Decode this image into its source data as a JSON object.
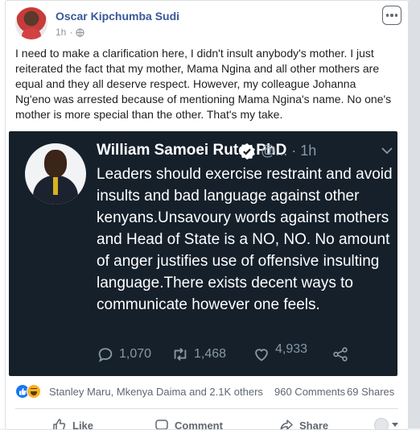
{
  "post": {
    "author": "Oscar Kipchumba Sudi",
    "time": "1h",
    "privacy_icon": "globe-icon",
    "text": "I need to make a clarification here, I didn't insult anybody's mother. I just reiterated the fact that my mother, Mama Ngina and all other mothers are equal and they all deserve respect. However, my colleague Johanna Ng'eno was arrested because of mentioning Mama Ngina's name. No one's mother is more special than the other. That's my take."
  },
  "tweet": {
    "name": "William Samoei Ruto, PhD",
    "handle": "@...",
    "time": "· 1h",
    "text": "Leaders should exercise restraint and avoid insults and bad language against other kenyans.Unsavoury words against mothers and Head of State is a NO, NO. No amount of anger justifies use of offensive insulting language.There exists decent ways to communicate however one feels.",
    "replies": "1,070",
    "retweets": "1,468",
    "likes": "4,933",
    "colors": {
      "background": "#15202b",
      "muted": "#8899a6",
      "verified": "#ffffff"
    }
  },
  "reactions": {
    "names": "Stanley Maru, Mkenya Daima and 2.1K others",
    "comments": "960 Comments",
    "shares": "69 Shares"
  },
  "actions": {
    "like": "Like",
    "comment": "Comment",
    "share": "Share"
  },
  "colors": {
    "author": "#385898",
    "like_blue": "#1877f2",
    "haha": "#f7b125"
  }
}
